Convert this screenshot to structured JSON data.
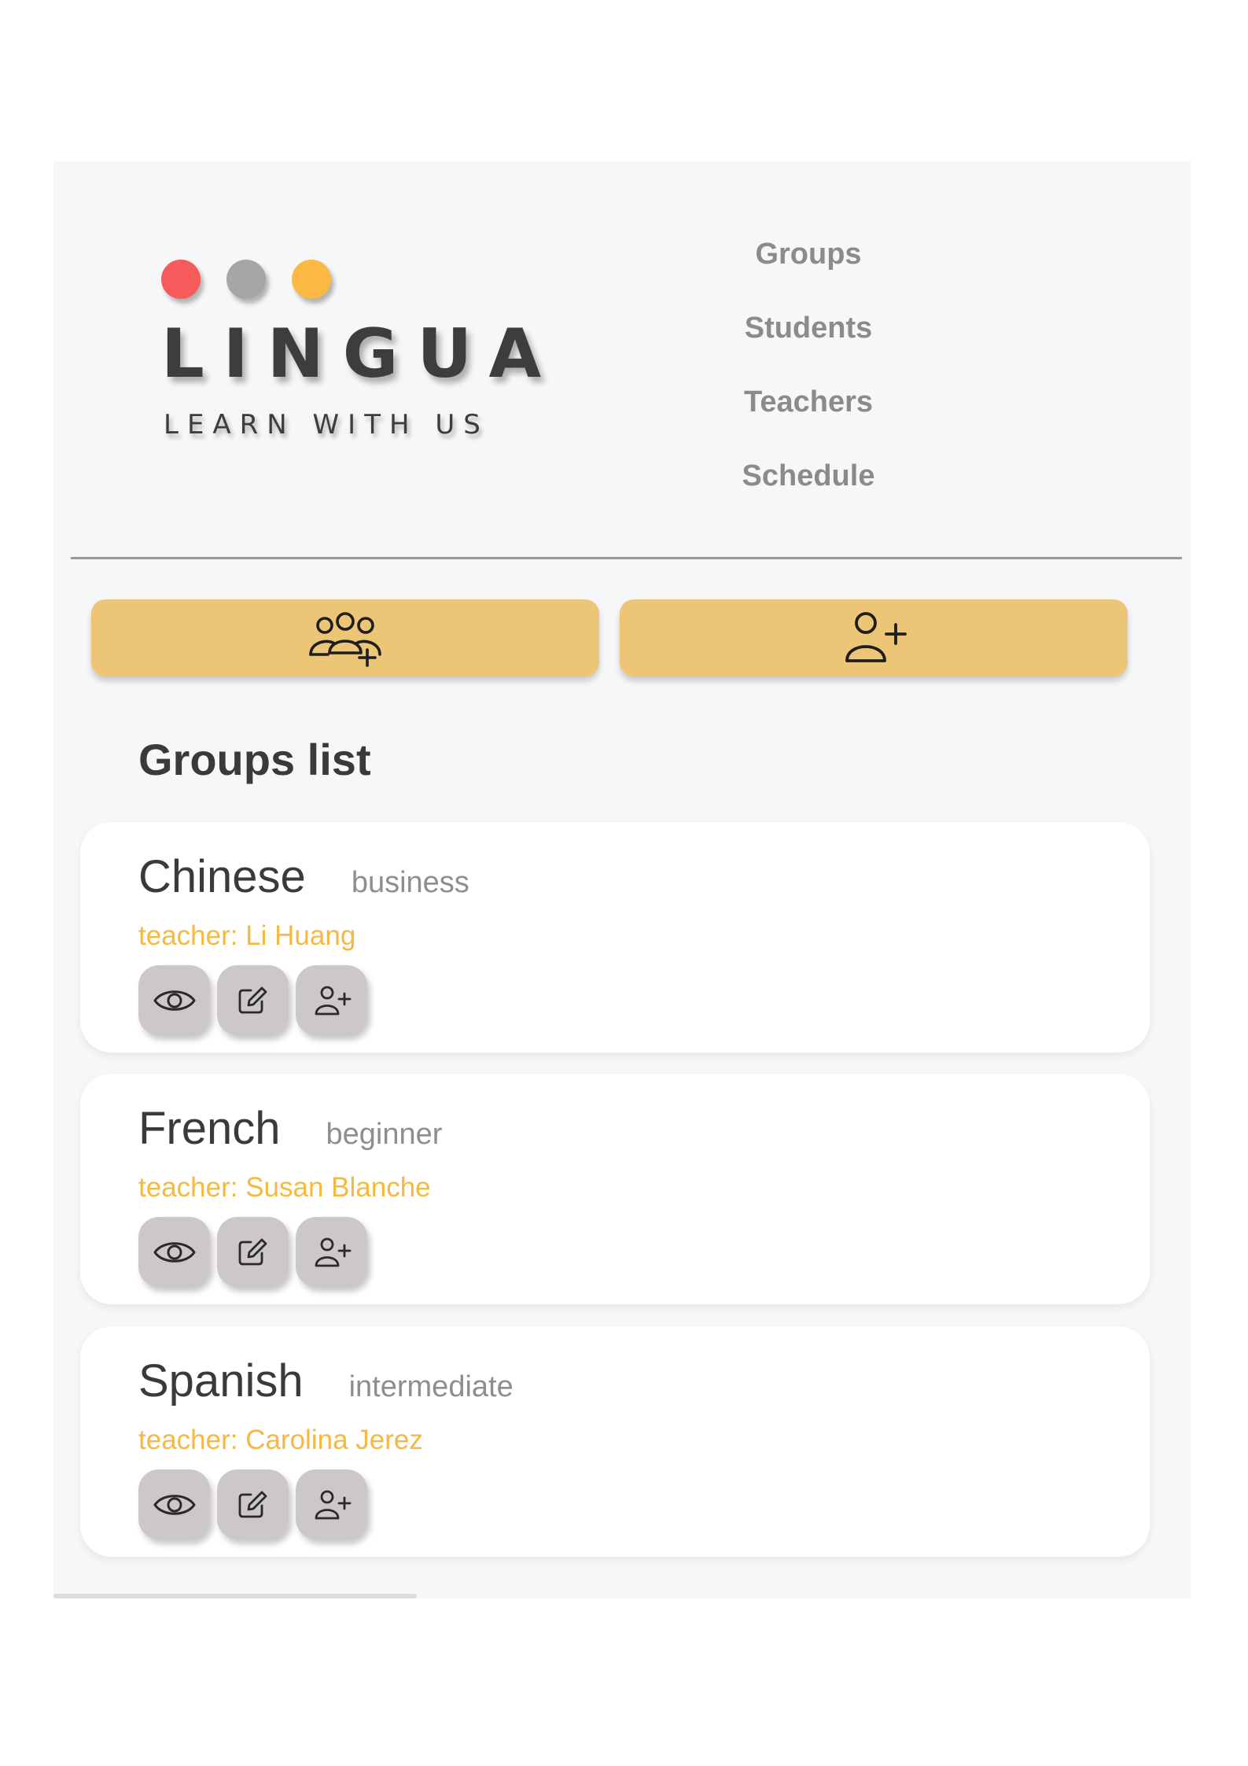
{
  "brand": {
    "name": "LINGUA",
    "tagline": "LEARN WITH US",
    "dot_colors": [
      "#f65a5b",
      "#a6a6a6",
      "#fbb843"
    ]
  },
  "nav": {
    "items": [
      {
        "label": "Groups"
      },
      {
        "label": "Students"
      },
      {
        "label": "Teachers"
      },
      {
        "label": "Schedule"
      }
    ]
  },
  "actions": {
    "add_group_icon": "users-plus-icon",
    "add_student_icon": "user-plus-icon"
  },
  "main": {
    "title": "Groups list",
    "groups": [
      {
        "language": "Chinese",
        "level": "business",
        "teacher": "teacher: Li Huang"
      },
      {
        "language": "French",
        "level": "beginner",
        "teacher": "teacher: Susan Blanche"
      },
      {
        "language": "Spanish",
        "level": "intermediate",
        "teacher": "teacher: Carolina Jerez"
      }
    ],
    "card_action_icons": [
      "eye-icon",
      "edit-icon",
      "user-plus-icon"
    ]
  },
  "colors": {
    "accent": "#ecc577",
    "teacher_text": "#f5b942",
    "icon_button": "#cdc8c8",
    "background": "#f6f7f9"
  }
}
